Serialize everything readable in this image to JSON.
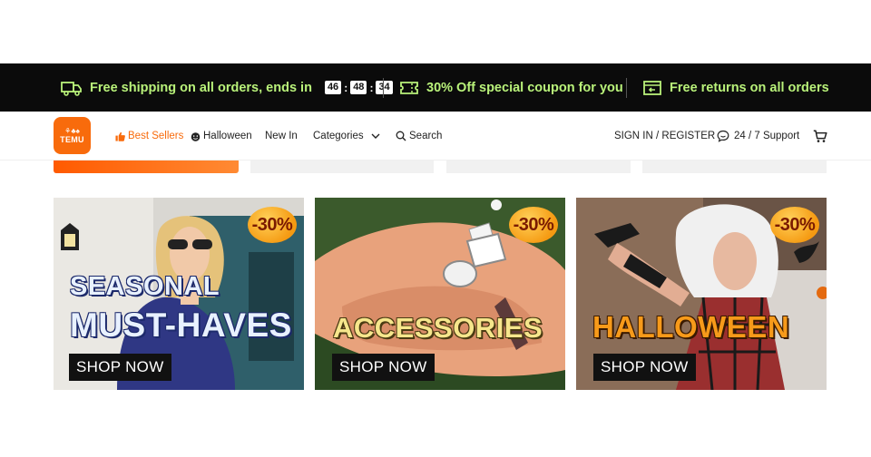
{
  "promo": {
    "shipping_text": "Free shipping on all orders, ends in",
    "countdown": [
      "46",
      "48",
      "34"
    ],
    "coupon_text": "30% Off special coupon for you",
    "returns_text": "Free returns on all orders",
    "accent_color": "#b9f27a"
  },
  "header": {
    "logo_text": "TEMU",
    "logo_glyphs": "⚘♣♠",
    "nav": {
      "best_sellers": "Best Sellers",
      "halloween": "Halloween",
      "new_in": "New In",
      "categories": "Categories",
      "search": "Search"
    },
    "sign_in": "SIGN IN / REGISTER",
    "support": "24 / 7 Support",
    "brand_color": "#f86b0c"
  },
  "cards": [
    {
      "badge": "-30%",
      "headline_line1": "SEASONAL",
      "headline_line2": "MUST-HAVES",
      "button": "SHOP NOW"
    },
    {
      "badge": "-30%",
      "headline_line1": "ACCESSORIES",
      "button": "SHOP NOW"
    },
    {
      "badge": "-30%",
      "headline_line1": "HALLOWEEN",
      "button": "SHOP NOW"
    }
  ]
}
